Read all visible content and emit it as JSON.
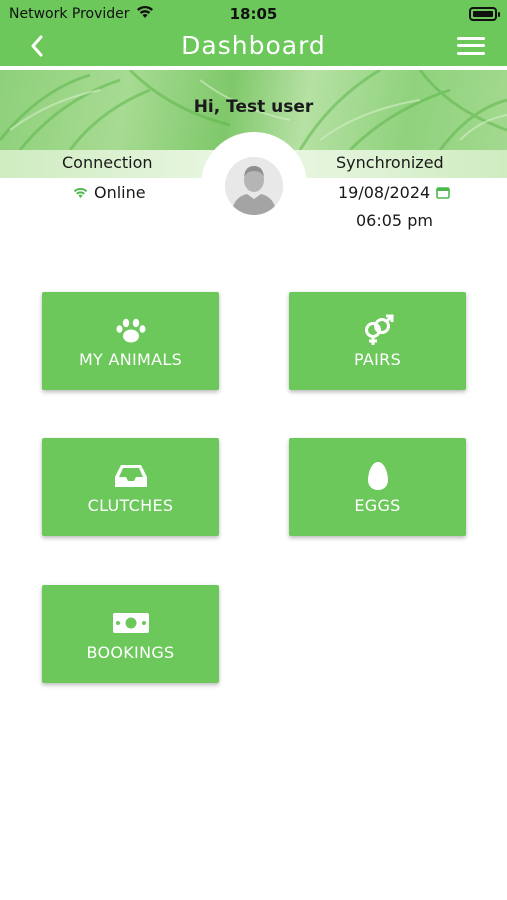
{
  "status_bar": {
    "carrier": "Network Provider",
    "time": "18:05"
  },
  "header": {
    "title": "Dashboard",
    "back_icon": "chevron-left-icon",
    "menu_icon": "hamburger-menu-icon"
  },
  "profile": {
    "greeting": "Hi, Test user",
    "connection_label": "Connection",
    "connection_status": "Online",
    "sync_label": "Synchronized",
    "sync_date": "19/08/2024",
    "sync_time": "06:05 pm"
  },
  "tiles": [
    {
      "label": "MY ANIMALS",
      "icon": "paw-icon"
    },
    {
      "label": "PAIRS",
      "icon": "gender-icon"
    },
    {
      "label": "CLUTCHES",
      "icon": "inbox-tray-icon"
    },
    {
      "label": "EGGS",
      "icon": "egg-icon"
    },
    {
      "label": "BOOKINGS",
      "icon": "money-bill-icon"
    }
  ],
  "colors": {
    "primary": "#6cc85b",
    "text": "#1a1a1a",
    "white": "#ffffff"
  }
}
